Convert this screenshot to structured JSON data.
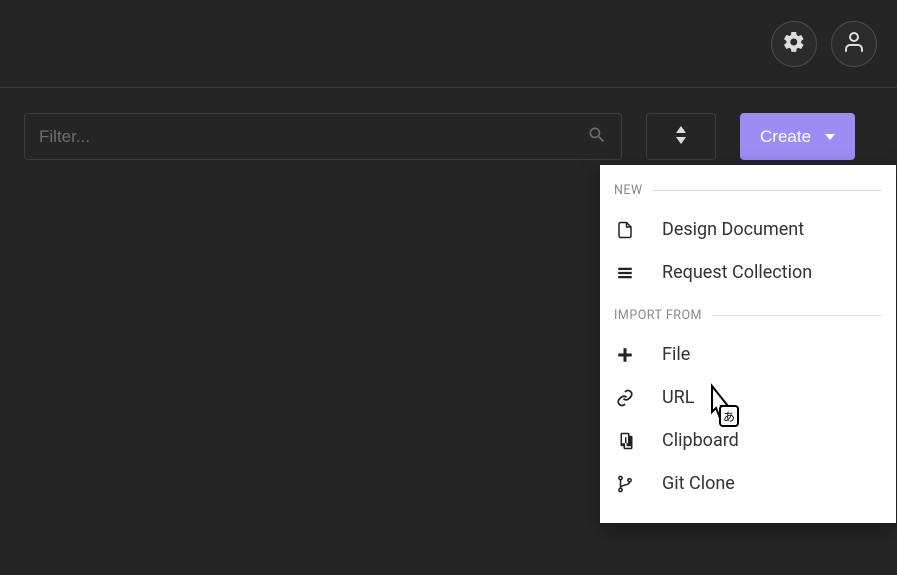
{
  "header": {},
  "toolbar": {
    "filter_placeholder": "Filter...",
    "create_label": "Create"
  },
  "dropdown": {
    "section_new_label": "NEW",
    "section_import_label": "IMPORT FROM",
    "new_items": [
      {
        "label": "Design Document"
      },
      {
        "label": "Request Collection"
      }
    ],
    "import_items": [
      {
        "label": "File"
      },
      {
        "label": "URL"
      },
      {
        "label": "Clipboard"
      },
      {
        "label": "Git Clone"
      }
    ]
  },
  "colors": {
    "accent": "#9d8cf3",
    "bg": "#252525"
  }
}
